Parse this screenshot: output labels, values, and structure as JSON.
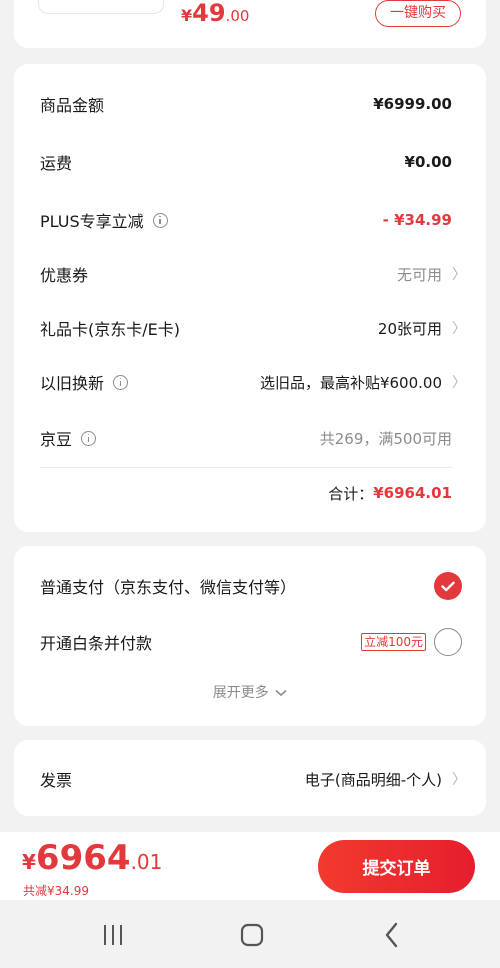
{
  "product": {
    "price_symbol": "¥",
    "price_int": "49",
    "price_dec": ".00",
    "buy_label": "一键购买"
  },
  "summary": {
    "goods_amount_label": "商品金额",
    "goods_amount_value": "¥6999.00",
    "shipping_label": "运费",
    "shipping_value": "¥0.00",
    "plus_label": "PLUS专享立减",
    "plus_value": "- ¥34.99",
    "coupon_label": "优惠券",
    "coupon_value": "无可用",
    "giftcard_label": "礼品卡(京东卡/E卡)",
    "giftcard_value": "20张可用",
    "tradein_label": "以旧换新",
    "tradein_value": "选旧品，最高补贴¥600.00",
    "jingdou_label": "京豆",
    "jingdou_value": "共269，满500可用",
    "total_label": "合计：",
    "total_value": "¥6964.01"
  },
  "payment": {
    "normal_label": "普通支付（京东支付、微信支付等）",
    "baitiao_label": "开通白条并付款",
    "baitiao_tag": "立减100元",
    "expand_label": "展开更多"
  },
  "invoice": {
    "label": "发票",
    "value": "电子(商品明细-个人)"
  },
  "bottom": {
    "price_symbol": "¥",
    "price_int": "6964",
    "price_dec": ".01",
    "saved_text": "共减¥34.99",
    "submit_label": "提交订单"
  },
  "icons": {
    "info": "info-icon",
    "chevron": "chevron-right-icon",
    "check": "check-icon",
    "expand": "chevron-down-icon",
    "nav_recent": "recent-apps-icon",
    "nav_home": "home-icon",
    "nav_back": "back-icon"
  },
  "colors": {
    "accent": "#e4393c",
    "background": "#f2f2f2"
  }
}
